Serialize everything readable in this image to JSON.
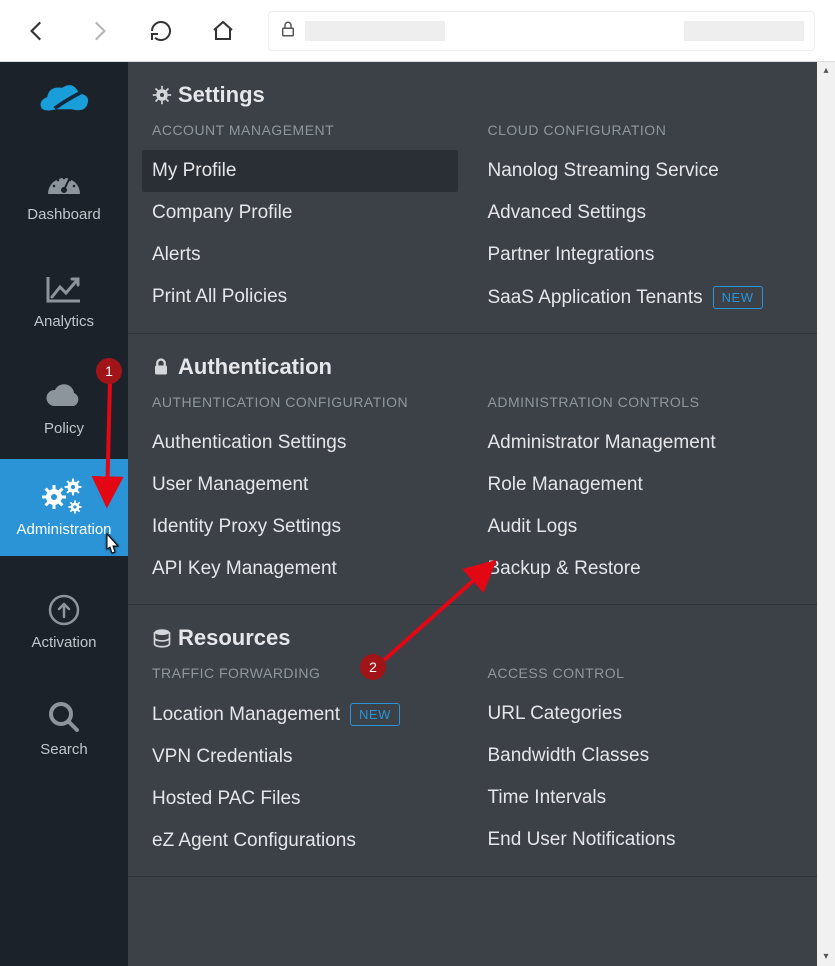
{
  "rail": {
    "items": [
      {
        "id": "dashboard",
        "label": "Dashboard"
      },
      {
        "id": "analytics",
        "label": "Analytics"
      },
      {
        "id": "policy",
        "label": "Policy"
      },
      {
        "id": "administration",
        "label": "Administration"
      },
      {
        "id": "activation",
        "label": "Activation"
      },
      {
        "id": "search",
        "label": "Search"
      }
    ]
  },
  "panel": {
    "sections": [
      {
        "title": "Settings",
        "columns": [
          {
            "header": "ACCOUNT MANAGEMENT",
            "links": [
              {
                "label": "My Profile",
                "selected": true
              },
              {
                "label": "Company Profile"
              },
              {
                "label": "Alerts"
              },
              {
                "label": "Print All Policies"
              }
            ]
          },
          {
            "header": "CLOUD CONFIGURATION",
            "links": [
              {
                "label": "Nanolog Streaming Service"
              },
              {
                "label": "Advanced Settings"
              },
              {
                "label": "Partner Integrations"
              },
              {
                "label": "SaaS Application Tenants",
                "badge": "NEW"
              }
            ]
          }
        ]
      },
      {
        "title": "Authentication",
        "columns": [
          {
            "header": "AUTHENTICATION CONFIGURATION",
            "links": [
              {
                "label": "Authentication Settings"
              },
              {
                "label": "User Management"
              },
              {
                "label": "Identity Proxy Settings"
              },
              {
                "label": "API Key Management"
              }
            ]
          },
          {
            "header": "ADMINISTRATION CONTROLS",
            "links": [
              {
                "label": "Administrator Management"
              },
              {
                "label": "Role Management"
              },
              {
                "label": "Audit Logs"
              },
              {
                "label": "Backup & Restore"
              }
            ]
          }
        ]
      },
      {
        "title": "Resources",
        "columns": [
          {
            "header": "TRAFFIC FORWARDING",
            "links": [
              {
                "label": "Location Management",
                "badge": "NEW"
              },
              {
                "label": "VPN Credentials"
              },
              {
                "label": "Hosted PAC Files"
              },
              {
                "label": "eZ Agent Configurations"
              }
            ]
          },
          {
            "header": "ACCESS CONTROL",
            "links": [
              {
                "label": "URL Categories"
              },
              {
                "label": "Bandwidth Classes"
              },
              {
                "label": "Time Intervals"
              },
              {
                "label": "End User Notifications"
              }
            ]
          }
        ]
      }
    ]
  },
  "annotations": {
    "step1": "1",
    "step2": "2"
  }
}
